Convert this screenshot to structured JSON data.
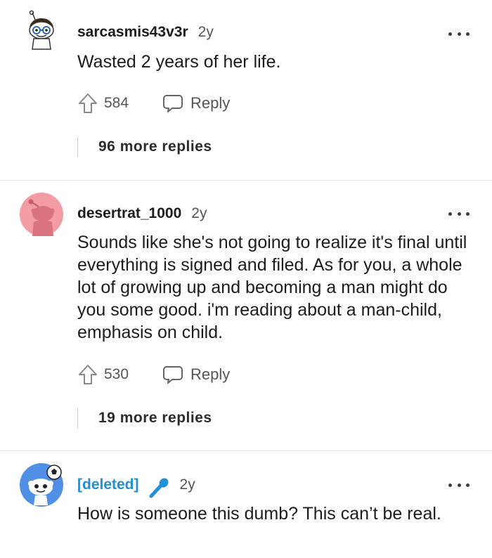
{
  "comments": [
    {
      "username": "sarcasmis43v3r",
      "age": "2y",
      "body": "Wasted 2 years of her life.",
      "upvotes": "584",
      "reply_label": "Reply",
      "more_replies": "96 more replies",
      "avatar_icon": "nerd-snoo-avatar-icon"
    },
    {
      "username": "desertrat_1000",
      "age": "2y",
      "body": "Sounds like she's not going to realize it's final until everything is signed and filed. As for you, a whole lot of growing up and becoming a man might do you some good. i'm reading about a man-child, emphasis on child.",
      "upvotes": "530",
      "reply_label": "Reply",
      "more_replies": "19 more replies",
      "avatar_icon": "default-snoo-avatar-icon"
    },
    {
      "username": "[deleted]",
      "age": "2y",
      "body": "How is someone this dumb? This can’t be real.",
      "avatar_icon": "snoo-soccer-avatar-icon",
      "flair_icon": "microphone-icon"
    }
  ],
  "colors": {
    "deleted_name": "#1f8fd6",
    "avatar_pink": "#f39ca4",
    "avatar_blue": "#4f8fe6"
  }
}
